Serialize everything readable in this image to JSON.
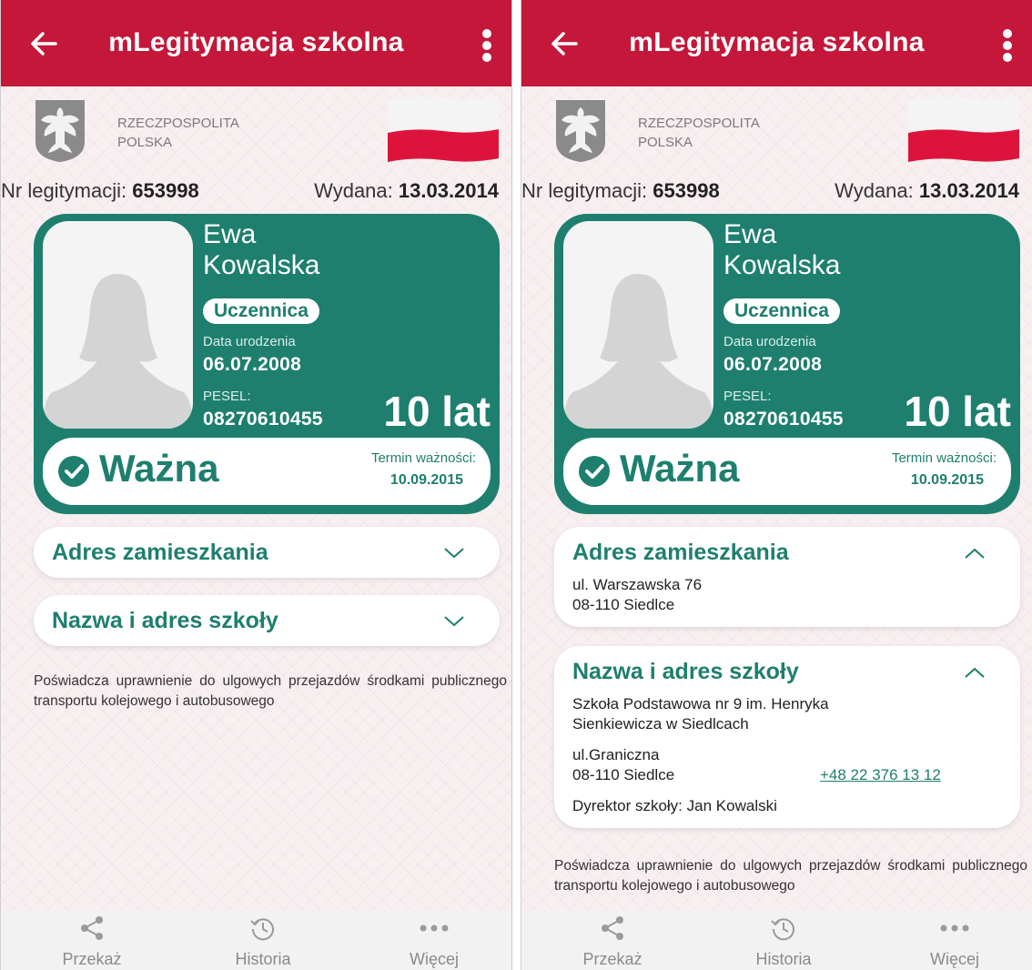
{
  "left": {
    "appbar": {
      "title": "mLegitymacja szkolna"
    },
    "header": {
      "country_line1": "RZECZPOSPOLITA",
      "country_line2": "POLSKA"
    },
    "id_row": {
      "nr_label": "Nr legitymacji:",
      "nr_value": "653998",
      "issued_label": "Wydana:",
      "issued_value": "13.03.2014"
    },
    "card": {
      "first_name": "Ewa",
      "last_name": "Kowalska",
      "role": "Uczennica",
      "birth_label": "Data urodzenia",
      "birth_value": "06.07.2008",
      "pesel_label": "PESEL:",
      "pesel_value": "08270610455",
      "age": "10 lat",
      "status": "Ważna",
      "expiry_label": "Termin ważności:",
      "expiry_value": "10.09.2015"
    },
    "address": {
      "title": "Adres zamieszkania"
    },
    "school": {
      "title": "Nazwa i adres szkoły"
    },
    "note": "Poświadcza uprawnienie do ulgowych przejazdów środkami publicznego transportu kolejowego i autobusowego",
    "bottom_nav": [
      {
        "label": "Przekaż"
      },
      {
        "label": "Historia"
      },
      {
        "label": "Więcej"
      }
    ]
  },
  "right": {
    "appbar": {
      "title": "mLegitymacja szkolna"
    },
    "header": {
      "country_line1": "RZECZPOSPOLITA",
      "country_line2": "POLSKA"
    },
    "id_row": {
      "nr_label": "Nr legitymacji:",
      "nr_value": "653998",
      "issued_label": "Wydana:",
      "issued_value": "13.03.2014"
    },
    "card": {
      "first_name": "Ewa",
      "last_name": "Kowalska",
      "role": "Uczennica",
      "birth_label": "Data urodzenia",
      "birth_value": "06.07.2008",
      "pesel_label": "PESEL:",
      "pesel_value": "08270610455",
      "age": "10 lat",
      "status": "Ważna",
      "expiry_label": "Termin ważności:",
      "expiry_value": "10.09.2015"
    },
    "address": {
      "title": "Adres zamieszkania",
      "street": "ul. Warszawska 76",
      "city": "08-110 Siedlce"
    },
    "school": {
      "title": "Nazwa i adres szkoły",
      "name_line1": "Szkoła Podstawowa nr 9 im. Henryka",
      "name_line2": "Sienkiewicza w Siedlcach",
      "street": "ul.Graniczna",
      "city": "08-110 Siedlce",
      "phone": "+48 22 376 13 12",
      "director_label": "Dyrektor szkoły:",
      "director_name": "Jan Kowalski"
    },
    "note": "Poświadcza uprawnienie do ulgowych przejazdów środkami publicznego transportu kolejowego i autobusowego",
    "bottom_nav": [
      {
        "label": "Przekaż"
      },
      {
        "label": "Historia"
      },
      {
        "label": "Więcej"
      }
    ]
  },
  "colors": {
    "appbar": "#c4173a",
    "card_green": "#1e7f6e",
    "flag_red": "#dc143c"
  },
  "icons": [
    "arrow-left-icon",
    "kebab-menu-icon",
    "eagle-emblem-icon",
    "poland-flag-icon",
    "check-circle-icon",
    "chevron-down-icon",
    "chevron-up-icon",
    "share-icon",
    "history-icon",
    "more-dots-icon"
  ]
}
